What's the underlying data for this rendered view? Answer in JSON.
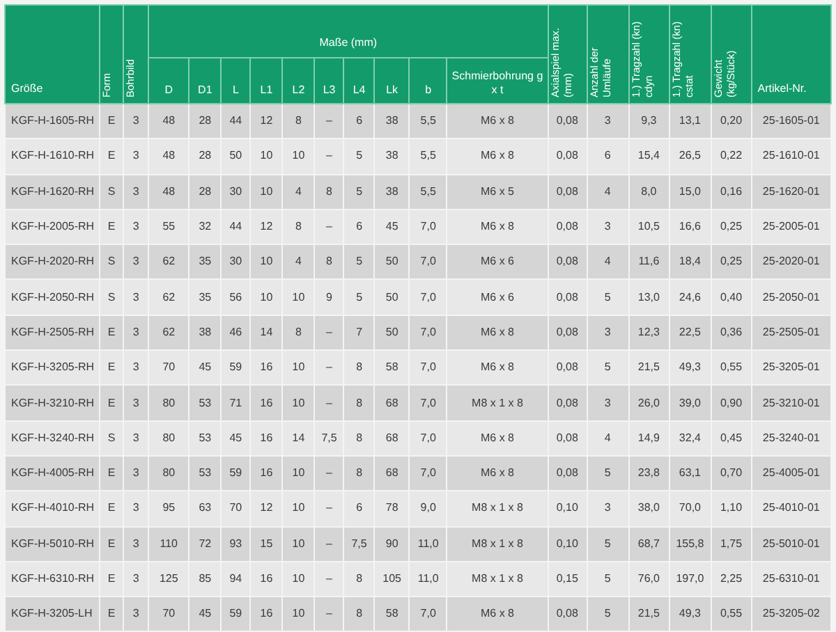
{
  "table": {
    "group_header": "Maße (mm)",
    "columns": [
      {
        "label": "Größe",
        "kind": "plain"
      },
      {
        "label": "Form",
        "kind": "vertical"
      },
      {
        "label": "Bohrbild",
        "kind": "vertical"
      },
      {
        "label": "D",
        "kind": "sub"
      },
      {
        "label": "D1",
        "kind": "sub"
      },
      {
        "label": "L",
        "kind": "sub"
      },
      {
        "label": "L1",
        "kind": "sub"
      },
      {
        "label": "L2",
        "kind": "sub"
      },
      {
        "label": "L3",
        "kind": "sub"
      },
      {
        "label": "L4",
        "kind": "sub"
      },
      {
        "label": "Lk",
        "kind": "sub"
      },
      {
        "label": "b",
        "kind": "sub"
      },
      {
        "label": "Schmierbohrung g x t",
        "kind": "sub"
      },
      {
        "label": "Axialspiel max. (mm)",
        "kind": "vertical"
      },
      {
        "label": "Anzahl der Umläufe",
        "kind": "vertical"
      },
      {
        "label": "1.) Tragzahl (kn) cdyn",
        "kind": "vertical"
      },
      {
        "label": "1.) Tragzahl (kn) cstat",
        "kind": "vertical"
      },
      {
        "label": "Gewicht (kg/Stück)",
        "kind": "vertical"
      },
      {
        "label": "Artikel-Nr.",
        "kind": "plain"
      }
    ],
    "rows": [
      [
        "KGF-H-1605-RH",
        "E",
        "3",
        "48",
        "28",
        "44",
        "12",
        "8",
        "–",
        "6",
        "38",
        "5,5",
        "M6 x 8",
        "0,08",
        "3",
        "9,3",
        "13,1",
        "0,20",
        "25-1605-01"
      ],
      [
        "KGF-H-1610-RH",
        "E",
        "3",
        "48",
        "28",
        "50",
        "10",
        "10",
        "–",
        "5",
        "38",
        "5,5",
        "M6 x 8",
        "0,08",
        "6",
        "15,4",
        "26,5",
        "0,22",
        "25-1610-01"
      ],
      [
        "KGF-H-1620-RH",
        "S",
        "3",
        "48",
        "28",
        "30",
        "10",
        "4",
        "8",
        "5",
        "38",
        "5,5",
        "M6 x 5",
        "0,08",
        "4",
        "8,0",
        "15,0",
        "0,16",
        "25-1620-01"
      ],
      [
        "KGF-H-2005-RH",
        "E",
        "3",
        "55",
        "32",
        "44",
        "12",
        "8",
        "–",
        "6",
        "45",
        "7,0",
        "M6 x 8",
        "0,08",
        "3",
        "10,5",
        "16,6",
        "0,25",
        "25-2005-01"
      ],
      [
        "KGF-H-2020-RH",
        "S",
        "3",
        "62",
        "35",
        "30",
        "10",
        "4",
        "8",
        "5",
        "50",
        "7,0",
        "M6 x 6",
        "0,08",
        "4",
        "11,6",
        "18,4",
        "0,25",
        "25-2020-01"
      ],
      [
        "KGF-H-2050-RH",
        "S",
        "3",
        "62",
        "35",
        "56",
        "10",
        "10",
        "9",
        "5",
        "50",
        "7,0",
        "M6 x 6",
        "0,08",
        "5",
        "13,0",
        "24,6",
        "0,40",
        "25-2050-01"
      ],
      [
        "KGF-H-2505-RH",
        "E",
        "3",
        "62",
        "38",
        "46",
        "14",
        "8",
        "–",
        "7",
        "50",
        "7,0",
        "M6 x 8",
        "0,08",
        "3",
        "12,3",
        "22,5",
        "0,36",
        "25-2505-01"
      ],
      [
        "KGF-H-3205-RH",
        "E",
        "3",
        "70",
        "45",
        "59",
        "16",
        "10",
        "–",
        "8",
        "58",
        "7,0",
        "M6 x 8",
        "0,08",
        "5",
        "21,5",
        "49,3",
        "0,55",
        "25-3205-01"
      ],
      [
        "KGF-H-3210-RH",
        "E",
        "3",
        "80",
        "53",
        "71",
        "16",
        "10",
        "–",
        "8",
        "68",
        "7,0",
        "M8 x 1 x 8",
        "0,08",
        "3",
        "26,0",
        "39,0",
        "0,90",
        "25-3210-01"
      ],
      [
        "KGF-H-3240-RH",
        "S",
        "3",
        "80",
        "53",
        "45",
        "16",
        "14",
        "7,5",
        "8",
        "68",
        "7,0",
        "M6 x 8",
        "0,08",
        "4",
        "14,9",
        "32,4",
        "0,45",
        "25-3240-01"
      ],
      [
        "KGF-H-4005-RH",
        "E",
        "3",
        "80",
        "53",
        "59",
        "16",
        "10",
        "–",
        "8",
        "68",
        "7,0",
        "M6 x 8",
        "0,08",
        "5",
        "23,8",
        "63,1",
        "0,70",
        "25-4005-01"
      ],
      [
        "KGF-H-4010-RH",
        "E",
        "3",
        "95",
        "63",
        "70",
        "12",
        "10",
        "–",
        "6",
        "78",
        "9,0",
        "M8 x 1 x 8",
        "0,10",
        "3",
        "38,0",
        "70,0",
        "1,10",
        "25-4010-01"
      ],
      [
        "KGF-H-5010-RH",
        "E",
        "3",
        "110",
        "72",
        "93",
        "15",
        "10",
        "–",
        "7,5",
        "90",
        "11,0",
        "M8 x 1 x 8",
        "0,10",
        "5",
        "68,7",
        "155,8",
        "1,75",
        "25-5010-01"
      ],
      [
        "KGF-H-6310-RH",
        "E",
        "3",
        "125",
        "85",
        "94",
        "16",
        "10",
        "–",
        "8",
        "105",
        "11,0",
        "M8 x 1 x 8",
        "0,15",
        "5",
        "76,0",
        "197,0",
        "2,25",
        "25-6310-01"
      ],
      [
        "KGF-H-3205-LH",
        "E",
        "3",
        "70",
        "45",
        "59",
        "16",
        "10",
        "–",
        "8",
        "58",
        "7,0",
        "M6 x 8",
        "0,08",
        "5",
        "21,5",
        "49,3",
        "0,55",
        "25-3205-02"
      ]
    ]
  }
}
